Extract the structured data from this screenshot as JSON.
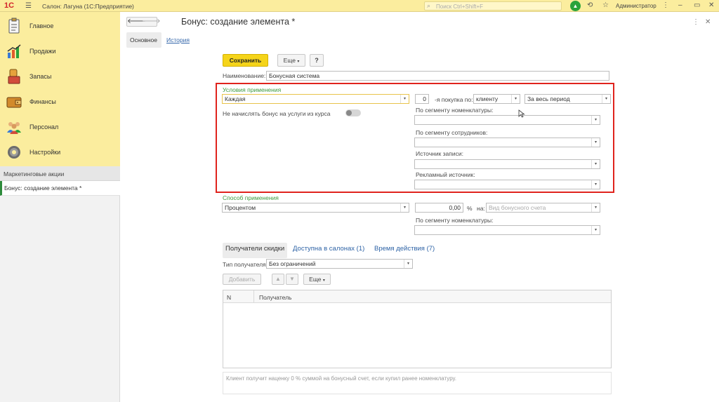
{
  "topbar": {
    "logo": "1С",
    "app_title": "Салон: Лагуна  (1С:Предприятие)",
    "search_placeholder": "Поиск Ctrl+Shift+F",
    "user": "Администратор"
  },
  "sidebar": {
    "items": [
      {
        "label": "Главное",
        "icon": "clipboard-icon"
      },
      {
        "label": "Продажи",
        "icon": "sales-chart-icon"
      },
      {
        "label": "Запасы",
        "icon": "stock-icon"
      },
      {
        "label": "Финансы",
        "icon": "wallet-icon"
      },
      {
        "label": "Персонал",
        "icon": "people-icon"
      },
      {
        "label": "Настройки",
        "icon": "gear-icon"
      }
    ],
    "section_label": "Маркетинговые акции",
    "open_window": "Бонус: создание элемента *"
  },
  "window": {
    "title": "Бонус: создание элемента *",
    "tabs": {
      "main": "Основное",
      "history": "История"
    }
  },
  "toolbar": {
    "save": "Сохранить",
    "more": "Еще",
    "help": "?"
  },
  "form": {
    "name_label": "Наименование:",
    "name_value": "Бонусная система",
    "conditions": {
      "group_label": "Условия применения",
      "type_value": "Каждая",
      "number_value": "0",
      "purchase_label": "-я покупка по:",
      "by_value": "клиенту",
      "period_value": "За весь период",
      "toggle_label": "Не начислять бонус на услуги из курса",
      "toggle_on": false,
      "segment_label": "По сегменту номенклатуры:",
      "staff_label": "По сегменту сотрудников:",
      "record_source_label": "Источник записи:",
      "ad_source_label": "Рекламный источник:"
    },
    "method": {
      "group_label": "Способ применения",
      "type_value": "Процентом",
      "percent_value": "0,00",
      "percent_unit": "%",
      "on_label": "на:",
      "account_placeholder": "Вид бонусного счета",
      "segment_label": "По сегменту номенклатуры:"
    }
  },
  "subtabs": {
    "recipients": "Получатели скидки",
    "salons": "Доступна в салонах (1)",
    "time": "Время действия (7)"
  },
  "recipients": {
    "type_label": "Тип получателя:",
    "type_value": "Без ограничений",
    "add_button": "Добавить",
    "more_button": "Еще",
    "columns": [
      "N",
      "Получатель"
    ]
  },
  "note": "Клиент получит наценку 0 % суммой на бонусный счет, если купил ранее номенклатуру.",
  "colors": {
    "panel_yellow": "#fbed9e",
    "save_yellow": "#f5d41a",
    "highlight_red": "#e0231d",
    "group_green": "#3e9a3e",
    "link_blue": "#2e63a6"
  }
}
